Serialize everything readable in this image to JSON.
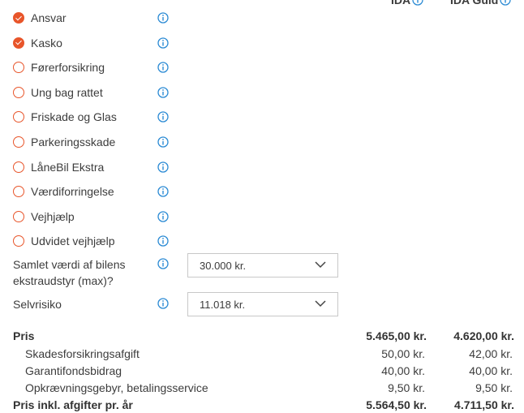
{
  "header": {
    "col1": "IDA",
    "col2": "IDA Guld"
  },
  "coverages": [
    {
      "label": "Ansvar",
      "checked": true
    },
    {
      "label": "Kasko",
      "checked": true
    },
    {
      "label": "Førerforsikring",
      "checked": false
    },
    {
      "label": "Ung bag rattet",
      "checked": false
    },
    {
      "label": "Friskade og Glas",
      "checked": false
    },
    {
      "label": "Parkeringsskade",
      "checked": false
    },
    {
      "label": "LåneBil Ekstra",
      "checked": false
    },
    {
      "label": "Værdiforringelse",
      "checked": false
    },
    {
      "label": "Vejhjælp",
      "checked": false
    },
    {
      "label": "Udvidet vejhjælp",
      "checked": false
    }
  ],
  "equipment": {
    "label": "Samlet værdi af bilens ekstraudstyr (max)?",
    "value": "30.000 kr."
  },
  "deductible": {
    "label": "Selvrisiko",
    "value": "11.018 kr."
  },
  "prices": {
    "price": {
      "label": "Pris",
      "ida": "5.465,00 kr.",
      "guld": "4.620,00 kr."
    },
    "fees": [
      {
        "label": "Skadesforsikringsafgift",
        "ida": "50,00 kr.",
        "guld": "42,00 kr."
      },
      {
        "label": "Garantifondsbidrag",
        "ida": "40,00 kr.",
        "guld": "40,00 kr."
      },
      {
        "label": "Opkrævningsgebyr, betalingsservice",
        "ida": "9,50 kr.",
        "guld": "9,50 kr."
      }
    ],
    "total": {
      "label": "Pris inkl. afgifter pr. år",
      "ida": "5.564,50 kr.",
      "guld": "4.711,50 kr."
    }
  },
  "colors": {
    "accent": "#e8552a",
    "info": "#2a8ad4",
    "text": "#3c3c3c"
  }
}
